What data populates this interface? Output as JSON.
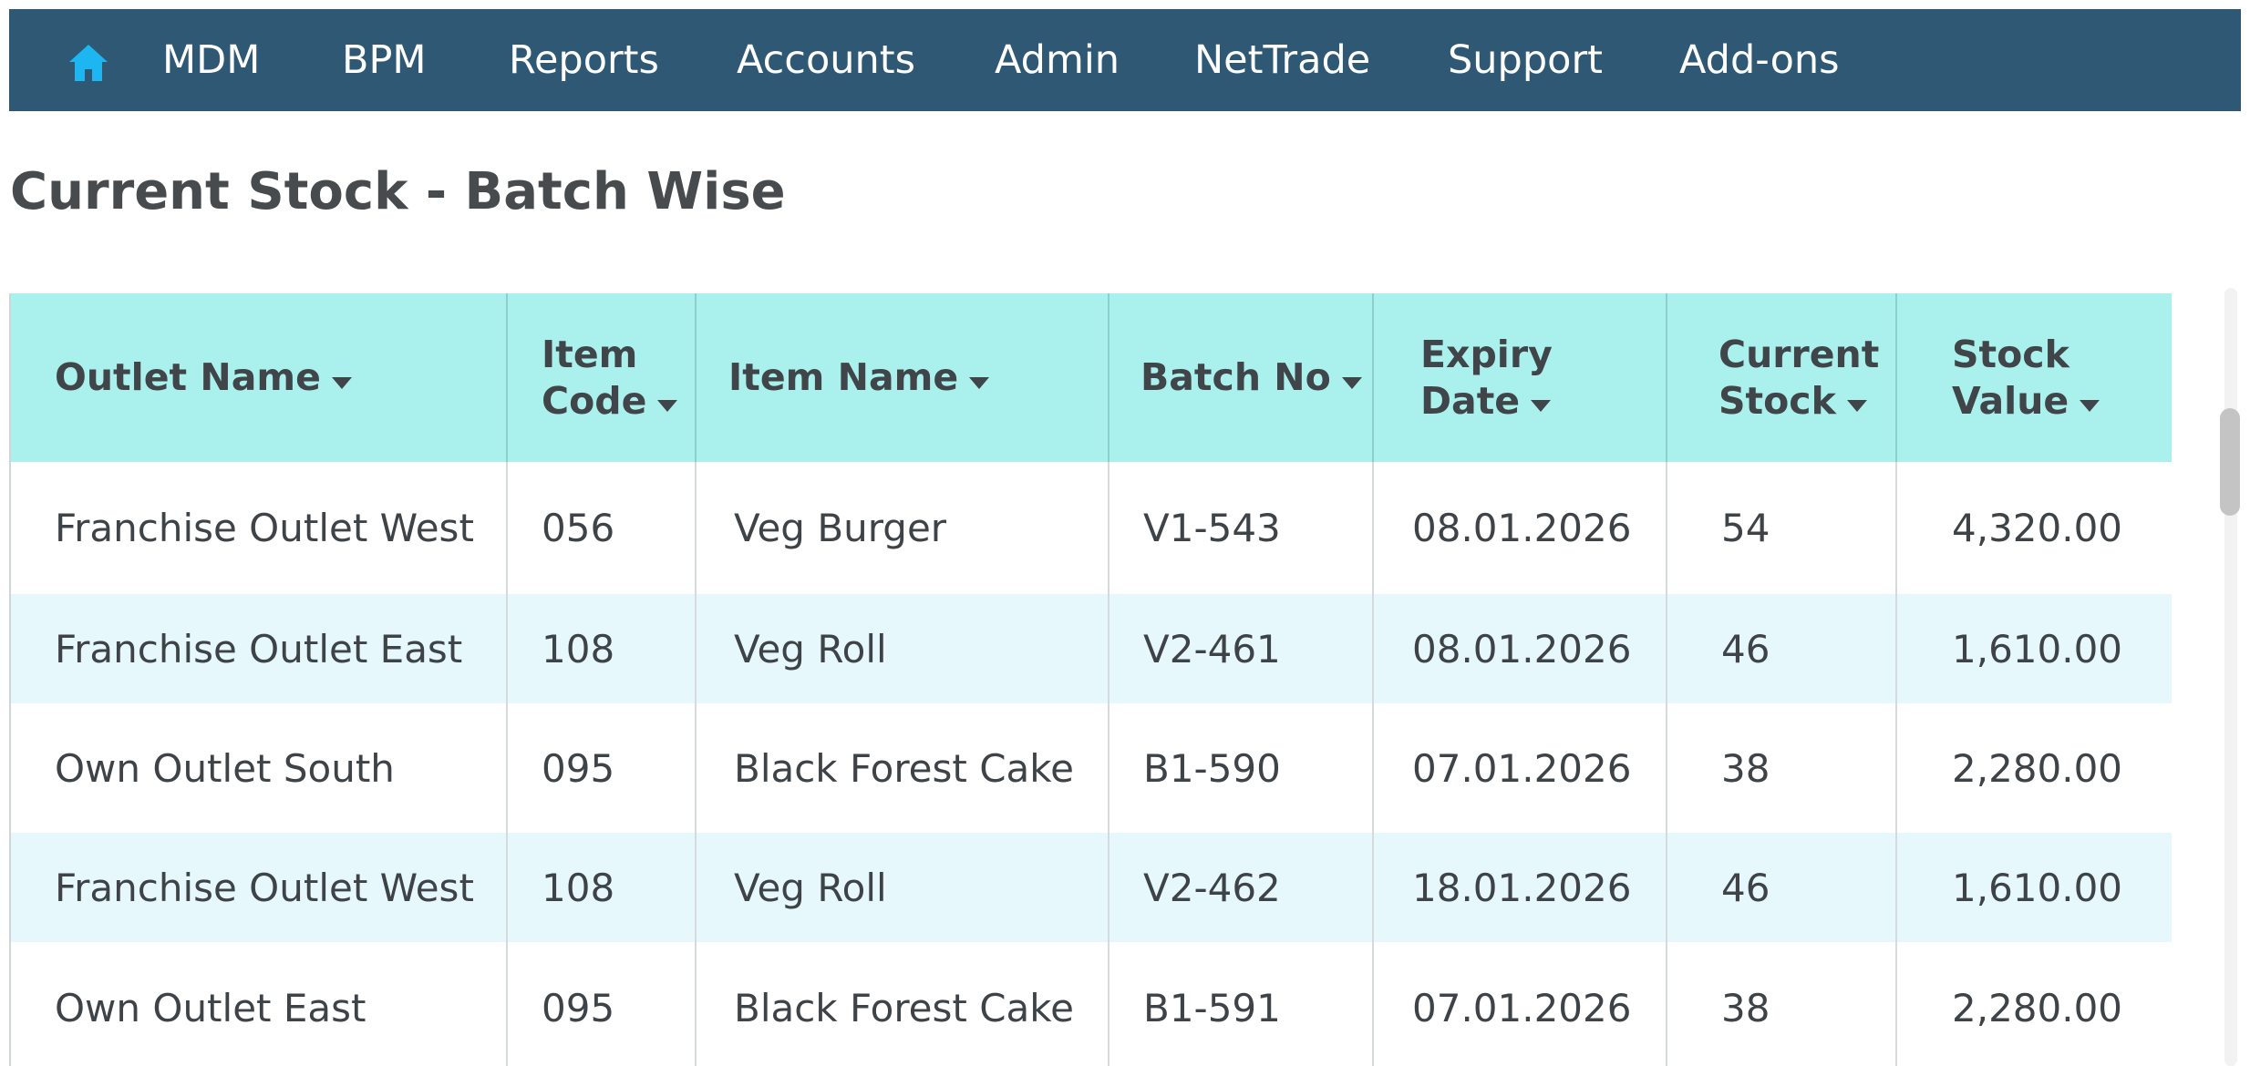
{
  "colors": {
    "nav_background": "#2e5873",
    "home_icon": "#1eb6f0",
    "header_background": "#aaf0ec",
    "row_alt_background": "#e6f8fb"
  },
  "nav": {
    "home_icon": "home-icon",
    "items": [
      "MDM",
      "BPM",
      "Reports",
      "Accounts",
      "Admin",
      "NetTrade",
      "Support",
      "Add-ons"
    ]
  },
  "page": {
    "title": "Current Stock - Batch Wise"
  },
  "table": {
    "columns": [
      {
        "line1": "Outlet Name",
        "line2": ""
      },
      {
        "line1": "Item",
        "line2": "Code"
      },
      {
        "line1": "Item Name",
        "line2": ""
      },
      {
        "line1": "Batch No",
        "line2": ""
      },
      {
        "line1": "Expiry",
        "line2": "Date"
      },
      {
        "line1": "Current",
        "line2": "Stock"
      },
      {
        "line1": "Stock",
        "line2": "Value"
      }
    ],
    "sort_icon": "caret-down-icon",
    "rows": [
      [
        "Franchise Outlet West",
        "056",
        "Veg Burger",
        "V1-543",
        "08.01.2026",
        "54",
        "4,320.00"
      ],
      [
        "Franchise Outlet East",
        "108",
        "Veg Roll",
        "V2-461",
        "08.01.2026",
        "46",
        "1,610.00"
      ],
      [
        "Own Outlet South",
        "095",
        "Black Forest Cake",
        "B1-590",
        "07.01.2026",
        "38",
        "2,280.00"
      ],
      [
        "Franchise Outlet West",
        "108",
        "Veg Roll",
        "V2-462",
        "18.01.2026",
        "46",
        "1,610.00"
      ],
      [
        "Own Outlet East",
        "095",
        "Black Forest Cake",
        "B1-591",
        "07.01.2026",
        "38",
        "2,280.00"
      ]
    ]
  }
}
